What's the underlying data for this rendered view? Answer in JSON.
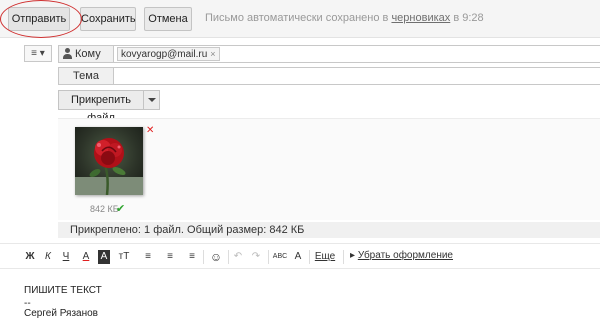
{
  "toolbar": {
    "send_label": "Отправить",
    "save_label": "Сохранить",
    "cancel_label": "Отмена",
    "autosave_prefix": "Письмо автоматически сохранено в",
    "autosave_link": "черновиках",
    "autosave_suffix": "в 9:28"
  },
  "header": {
    "menu_icon": "≡ ▾",
    "to_label": "Кому",
    "recipient": "kovyarogp@mail.ru",
    "recipient_remove": "×",
    "subject_label": "Тема",
    "subject_value": ""
  },
  "attach": {
    "button_label": "Прикрепить файл",
    "file_size": "842 КБ",
    "remove_icon": "close-icon",
    "status_icon": "check-icon",
    "summary": "Прикреплено: 1 файл. Общий размер: 842 КБ"
  },
  "format": {
    "bold": "Ж",
    "italic": "К",
    "underline": "Ч",
    "font_color": "А",
    "bg_color": "А",
    "font_size": "тТ",
    "align": "≡",
    "indent": "≡",
    "list": "≡",
    "emoji": "☺",
    "undo": "↶",
    "redo": "↷",
    "spell": "ABC",
    "translit": "A",
    "more": "Еще",
    "remove_format": "Убрать оформление"
  },
  "body": {
    "text": "ПИШИТЕ ТЕКСТ",
    "signature_sep": "--",
    "signature_name": "Сергей Рязанов"
  },
  "colors": {
    "accent_red": "#d03030",
    "check_green": "#2ea42e"
  }
}
